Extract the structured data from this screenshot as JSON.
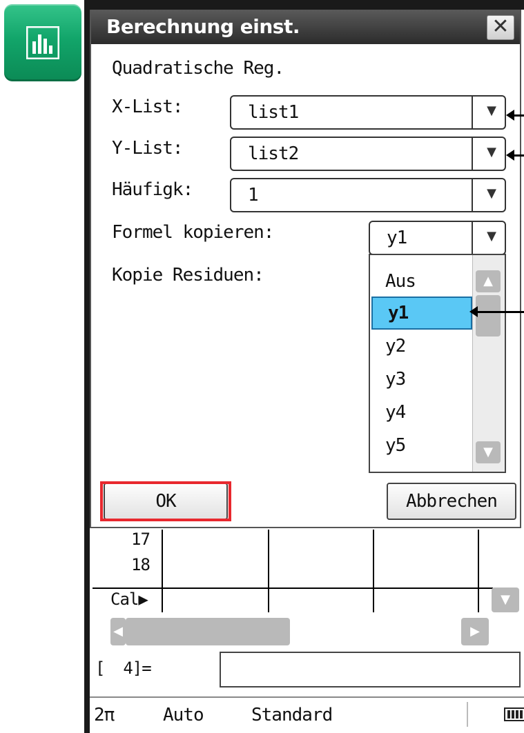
{
  "app_icon": {
    "icon": "stat-histogram-icon"
  },
  "dialog": {
    "title": "Berechnung einst.",
    "close_label": "✕",
    "calc_type": "Quadratische Reg.",
    "fields": {
      "xlist": {
        "label": "X-List:",
        "value": "list1"
      },
      "ylist": {
        "label": "Y-List:",
        "value": "list2"
      },
      "freq": {
        "label": "Häufigk:",
        "value": "1"
      },
      "copy_formula": {
        "label": "Formel kopieren:",
        "value": "y1"
      },
      "copy_residual": {
        "label": "Kopie Residuen:"
      }
    },
    "dropdown_options": [
      "Aus",
      "y1",
      "y2",
      "y3",
      "y4",
      "y5"
    ],
    "dropdown_selected": "y1",
    "ok_label": "OK",
    "cancel_label": "Abbrechen"
  },
  "spreadsheet": {
    "row_17": "17",
    "row_18": "18",
    "cal_label": "Cal▶",
    "entry_label": "[  4]="
  },
  "statusbar": {
    "angle": "2π",
    "mode": "Auto",
    "format": "Standard",
    "battery_icon": "battery-icon"
  },
  "colors": {
    "selection": "#5ac8f5",
    "highlight_outline": "#e8282e",
    "app_icon_green": "#12a56a"
  }
}
